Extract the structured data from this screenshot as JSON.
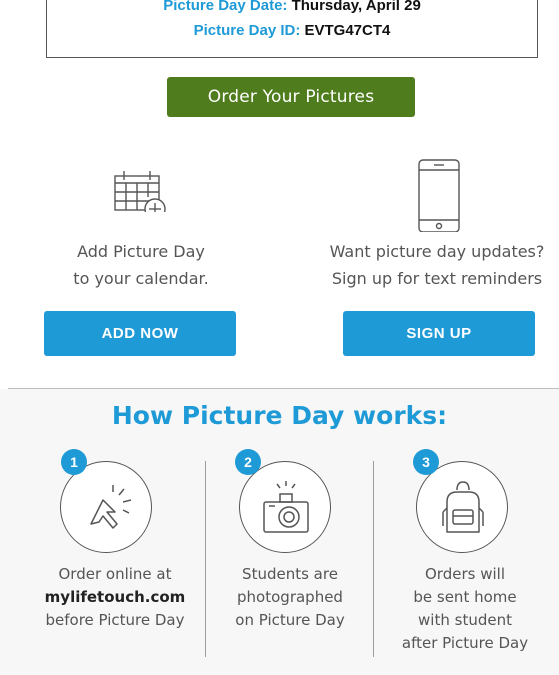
{
  "info": {
    "date_label": "Picture Day Date:",
    "date_value": "Thursday, April 29",
    "id_label": "Picture Day ID:",
    "id_value": "EVTG47CT4"
  },
  "order_button": "Order Your Pictures",
  "calendar": {
    "line1": "Add Picture Day",
    "line2": "to your calendar.",
    "button": "ADD NOW"
  },
  "updates": {
    "line1": "Want picture day updates?",
    "line2": "Sign up for text reminders",
    "button": "SIGN UP"
  },
  "how": {
    "title": "How Picture Day works:",
    "steps": [
      {
        "number": "1",
        "line1": "Order online at",
        "line2": "mylifetouch.com",
        "line3": "before Picture Day",
        "icon": "cursor-click-icon"
      },
      {
        "number": "2",
        "line1": "Students are",
        "line2": "photographed",
        "line3": "on Picture Day",
        "icon": "camera-icon"
      },
      {
        "number": "3",
        "line1": "Orders will",
        "line2": "be sent home",
        "line3": "with student",
        "line4": "after Picture Day",
        "icon": "backpack-icon"
      }
    ]
  },
  "colors": {
    "accent_blue": "#1e9ad6",
    "order_green": "#4f7c1c"
  }
}
